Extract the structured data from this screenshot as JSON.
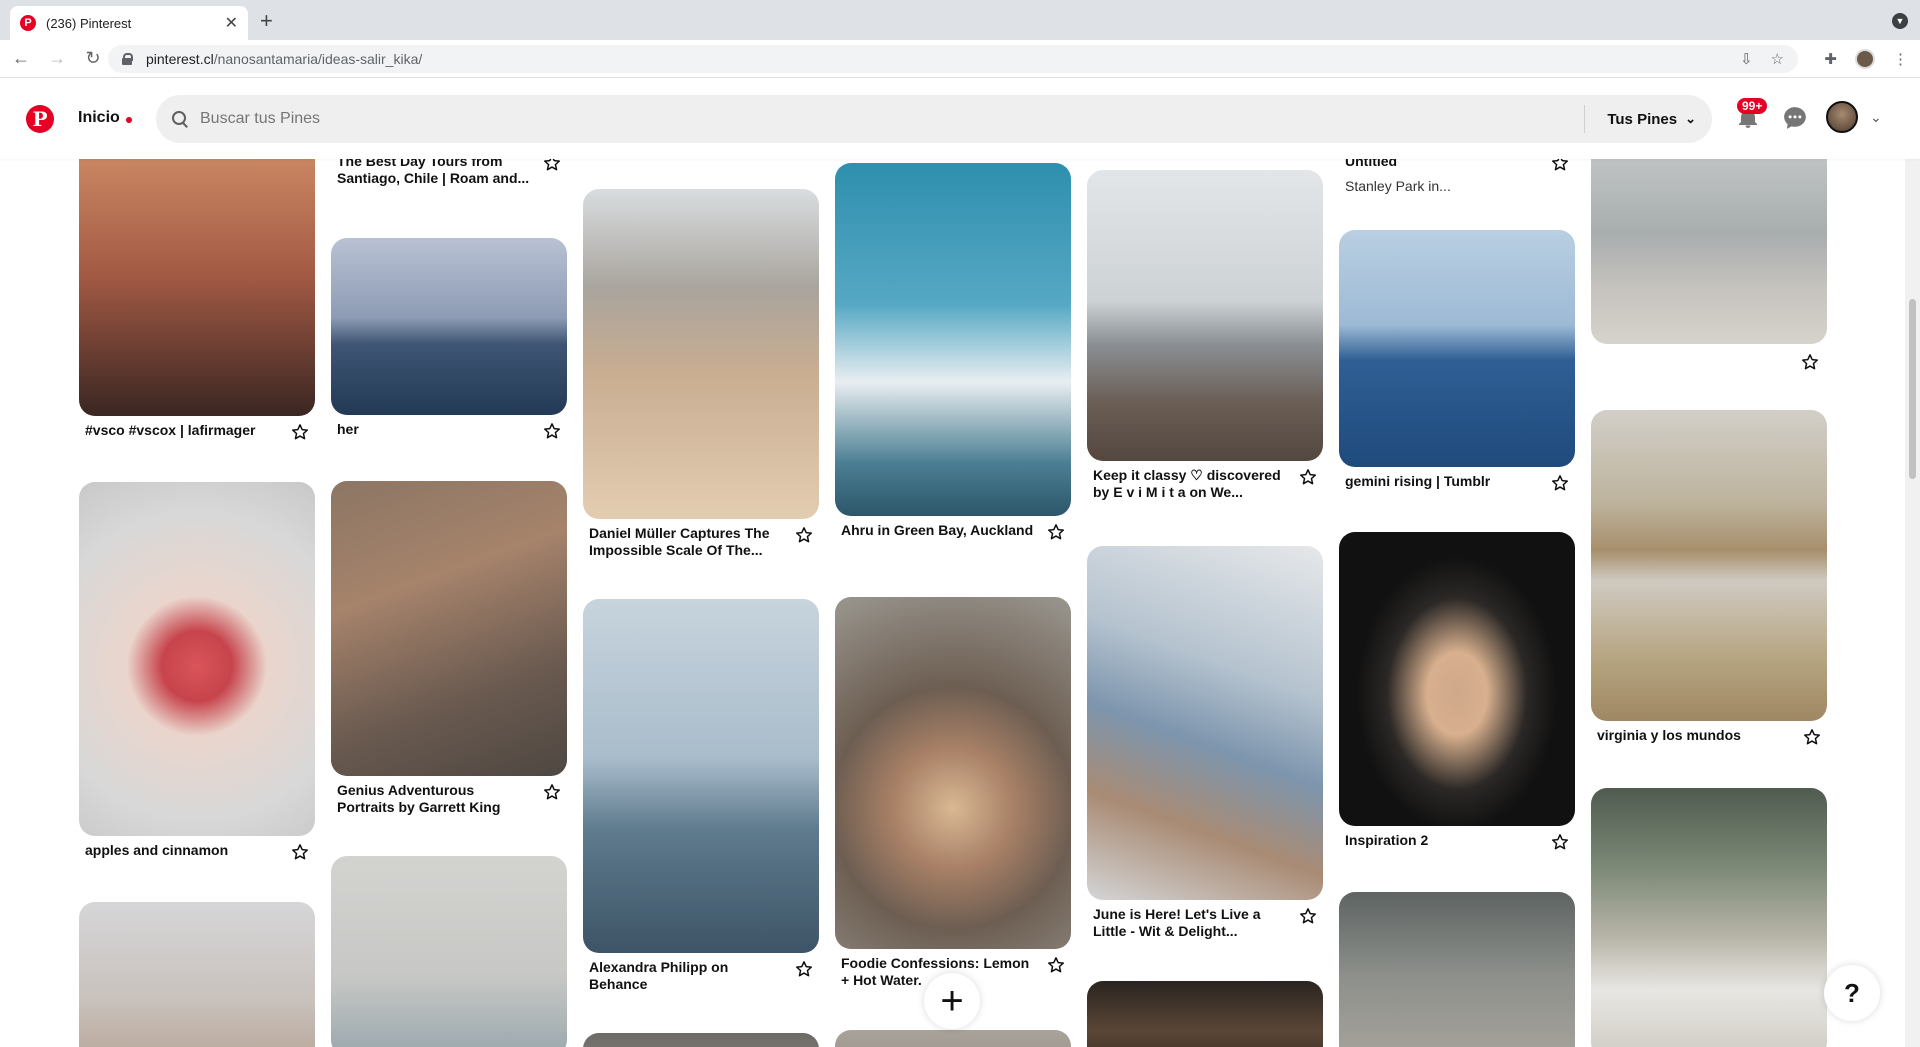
{
  "browser": {
    "tab_title": "(236) Pinterest",
    "url_host": "pinterest.cl",
    "url_path": "/nanosantamaria/ideas-salir_kika/"
  },
  "header": {
    "home_label": "Inicio",
    "search_placeholder": "Buscar tus Pines",
    "filter_label": "Tus Pines",
    "notification_count": "99+"
  },
  "colors": {
    "brand": "#e60023"
  },
  "pins": [
    {
      "title": "The Best Day Tours from Santiago, Chile | Roam and..."
    },
    {
      "title": "Untitled",
      "sub": "Stanley Park in..."
    },
    {
      "title": "#vsco #vscox | lafirmager"
    },
    {
      "title": "her"
    },
    {
      "title": "Daniel Müller Captures The Impossible Scale Of The..."
    },
    {
      "title": "Ahru in Green Bay, Auckland"
    },
    {
      "title": "Keep it classy ♡ discovered by E v i M i t a on We..."
    },
    {
      "title": "gemini rising | Tumblr"
    },
    {
      "title": "apples and cinnamon"
    },
    {
      "title": "Genius Adventurous Portraits by Garrett King"
    },
    {
      "title": "Alexandra Philipp on Behance"
    },
    {
      "title": "Foodie Confessions: Lemon + Hot Water."
    },
    {
      "title": "June is Here! Let's Live a Little - Wit & Delight..."
    },
    {
      "title": "Inspiration 2"
    },
    {
      "title": "virginia y los mundos"
    }
  ],
  "help_label": "?"
}
